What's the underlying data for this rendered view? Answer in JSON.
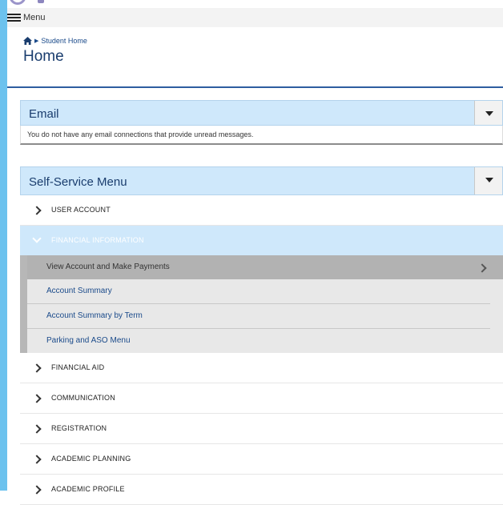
{
  "menubar": {
    "label": "Menu"
  },
  "breadcrumb": {
    "items": [
      "Student Home"
    ]
  },
  "page": {
    "title": "Home"
  },
  "email_panel": {
    "title": "Email",
    "message": "You do not have any email connections that provide unread messages."
  },
  "self_service": {
    "title": "Self-Service Menu",
    "items": [
      {
        "label": "USER ACCOUNT"
      },
      {
        "label": "FINANCIAL INFORMATION",
        "expanded": true,
        "children": [
          {
            "label": "View Account and Make Payments"
          },
          {
            "label": "Account Summary"
          },
          {
            "label": "Account Summary by Term"
          },
          {
            "label": "Parking and ASO Menu"
          }
        ]
      },
      {
        "label": "FINANCIAL AID"
      },
      {
        "label": "COMMUNICATION"
      },
      {
        "label": "REGISTRATION"
      },
      {
        "label": "ACADEMIC PLANNING"
      },
      {
        "label": "ACADEMIC PROFILE"
      }
    ]
  },
  "colors": {
    "accent": "#1a3d6e",
    "panel_header": "#cfe8fb",
    "left_rail": "#6cc2ee"
  }
}
